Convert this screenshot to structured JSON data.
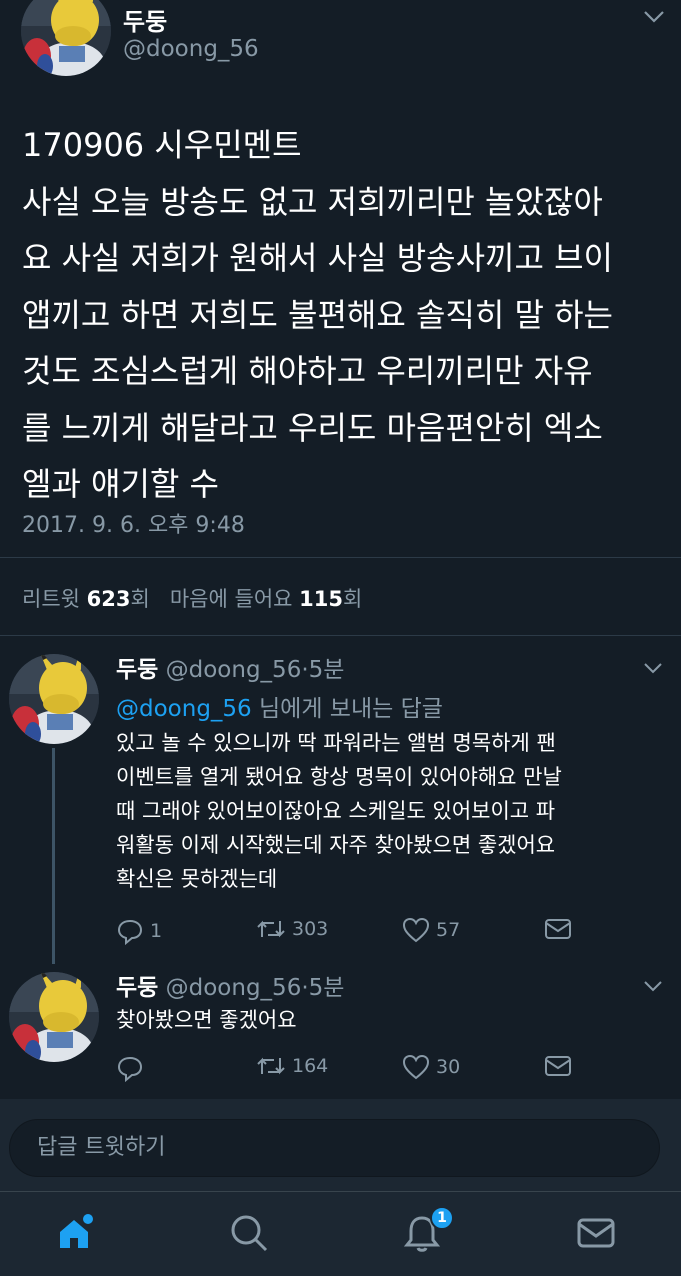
{
  "tweet": {
    "author_name": "두둥",
    "author_handle": "@doong_56",
    "text": "170906 시우민멘트\n사실 오늘 방송도 없고 저희끼리만 놀았잖아\n요 사실 저희가 원해서 사실 방송사끼고 브이\n앱끼고 하면 저희도 불편해요 솔직히 말 하는\n것도 조심스럽게 해야하고 우리끼리만 자유\n를 느끼게 해달라고 우리도 마음편안히 엑소\n엘과 얘기할 수",
    "timestamp": "2017. 9. 6. 오후 9:48",
    "stats": {
      "retweet_label": "리트윗",
      "retweet_count": "623",
      "retweet_unit": "회",
      "like_label": "마음에 들어요",
      "like_count": "115",
      "like_unit": "회"
    }
  },
  "replies": [
    {
      "author_name": "두둥",
      "author_handle": "@doong_56",
      "dot": "·",
      "age": "5분",
      "reply_to_handle": "@doong_56",
      "reply_to_suffix": " 님에게 보내는 답글",
      "text": "있고 놀 수 있으니까 딱 파워라는 앨범 명목하게 팬\n이벤트를 열게 됐어요 항상 명목이 있어야해요 만날\n때 그래야 있어보이잖아요 스케일도 있어보이고 파\n워활동 이제 시작했는데 자주 찾아봤으면 좋겠어요\n확신은 못하겠는데",
      "replies_count": "1",
      "retweets_count": "303",
      "likes_count": "57"
    },
    {
      "author_name": "두둥",
      "author_handle": "@doong_56",
      "dot": "·",
      "age": "5분",
      "text": "찾아봤으면 좋겠어요",
      "replies_count": "",
      "retweets_count": "164",
      "likes_count": "30"
    }
  ],
  "compose": {
    "placeholder": "답글 트윗하기"
  },
  "tabbar": {
    "items": [
      "home-icon",
      "search-icon",
      "notifications-icon",
      "messages-icon"
    ],
    "notification_badge": "1",
    "accent_color": "#1da1f2"
  },
  "icons": {
    "avatar": "pikachu-costume-avatar",
    "caret": "chevron-down-icon",
    "reply": "reply-icon",
    "retweet": "retweet-icon",
    "like": "heart-icon",
    "dm": "envelope-icon"
  }
}
